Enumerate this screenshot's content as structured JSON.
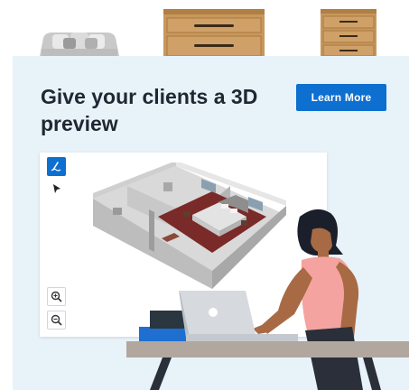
{
  "promo": {
    "headline": "Give your clients a 3D preview",
    "learn_more_label": "Learn More",
    "accent_color": "#0d6fcf",
    "background_color": "#e8f2f9"
  },
  "viewer": {
    "tools": [
      "draw-icon",
      "pointer-icon"
    ],
    "zoom_controls": [
      "zoom-in-icon",
      "zoom-out-icon"
    ]
  },
  "products": [
    "sofa",
    "wooden-dresser",
    "wooden-chest-of-drawers"
  ]
}
